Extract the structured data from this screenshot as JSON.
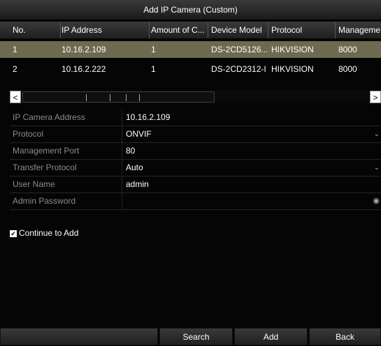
{
  "dialog": {
    "title": "Add IP Camera (Custom)"
  },
  "table": {
    "columns": [
      "No.",
      "IP Address",
      "Amount of C...",
      "Device Model",
      "Protocol",
      "Manageme"
    ],
    "rows": [
      [
        "1",
        "10.16.2.109",
        "1",
        "DS-2CD5126...",
        "HIKVISION",
        "8000"
      ],
      [
        "2",
        "10.16.2.222",
        "1",
        "DS-2CD2312-I",
        "HIKVISION",
        "8000"
      ]
    ],
    "selected_row": 0
  },
  "scrollbar": {
    "left_icon": "<",
    "right_icon": ">"
  },
  "form": {
    "ip_camera_address": {
      "label": "IP Camera Address",
      "value": "10.16.2.109"
    },
    "protocol": {
      "label": "Protocol",
      "value": "ONVIF"
    },
    "management_port": {
      "label": "Management Port",
      "value": "80"
    },
    "transfer_protocol": {
      "label": "Transfer Protocol",
      "value": "Auto"
    },
    "user_name": {
      "label": "User Name",
      "value": "admin"
    },
    "admin_password": {
      "label": "Admin Password",
      "value": ""
    }
  },
  "continue_to_add": {
    "label": "Continue to Add",
    "checked": true
  },
  "buttons": {
    "search": "Search",
    "add": "Add",
    "back": "Back"
  },
  "colors": {
    "selected_row": "#6e6a50",
    "background": "#050505",
    "label_gray": "#8c8c8c"
  }
}
